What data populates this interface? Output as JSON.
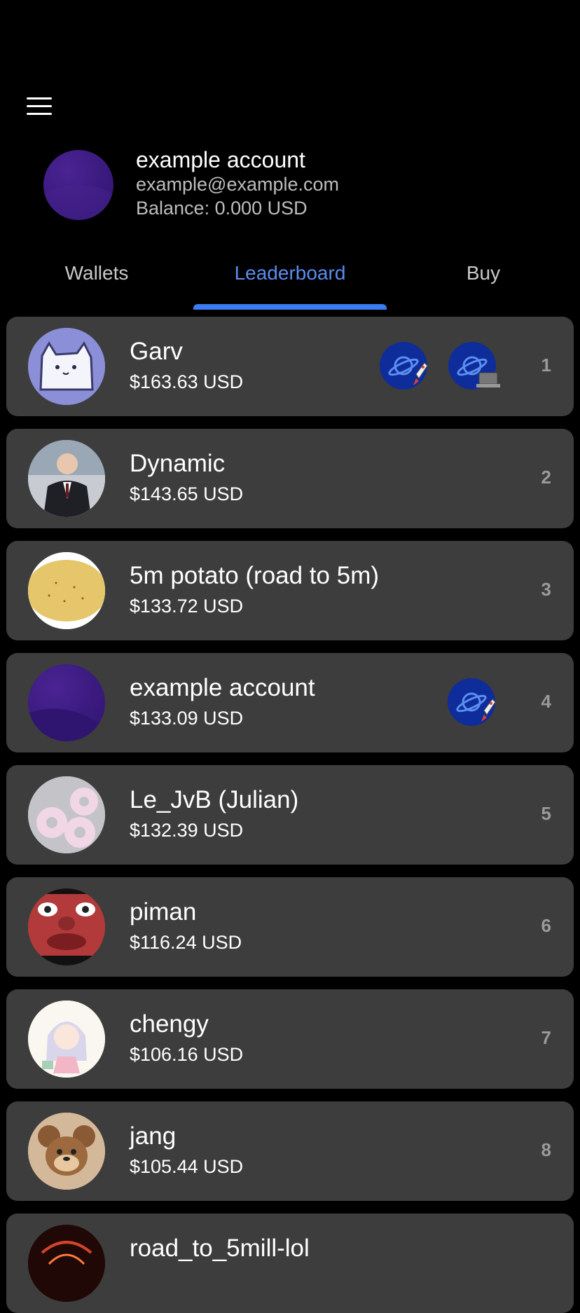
{
  "profile": {
    "name": "example account",
    "email": "example@example.com",
    "balance": "Balance: 0.000 USD"
  },
  "tabs": {
    "wallets": "Wallets",
    "leaderboard": "Leaderboard",
    "buy": "Buy",
    "active": "leaderboard"
  },
  "leaderboard": [
    {
      "name": "Garv",
      "amount": "$163.63 USD",
      "rank": "1",
      "badges": [
        "planet-rocket-icon",
        "planet-laptop-icon"
      ]
    },
    {
      "name": "Dynamic",
      "amount": "$143.65 USD",
      "rank": "2",
      "badges": []
    },
    {
      "name": "5m potato (road to 5m)",
      "amount": "$133.72 USD",
      "rank": "3",
      "badges": []
    },
    {
      "name": "example account",
      "amount": "$133.09 USD",
      "rank": "4",
      "badges": [
        "planet-rocket-icon"
      ]
    },
    {
      "name": "Le_JvB (Julian)",
      "amount": "$132.39 USD",
      "rank": "5",
      "badges": []
    },
    {
      "name": "piman",
      "amount": "$116.24 USD",
      "rank": "6",
      "badges": []
    },
    {
      "name": "chengy",
      "amount": "$106.16 USD",
      "rank": "7",
      "badges": []
    },
    {
      "name": "jang",
      "amount": "$105.44 USD",
      "rank": "8",
      "badges": []
    },
    {
      "name": "road_to_5mill-lol",
      "amount": "",
      "rank": "",
      "badges": []
    }
  ],
  "colors": {
    "accent": "#3b7cf0",
    "active_tab_text": "#5b8cf0",
    "row_bg": "#3d3d3d",
    "background": "#000000"
  }
}
